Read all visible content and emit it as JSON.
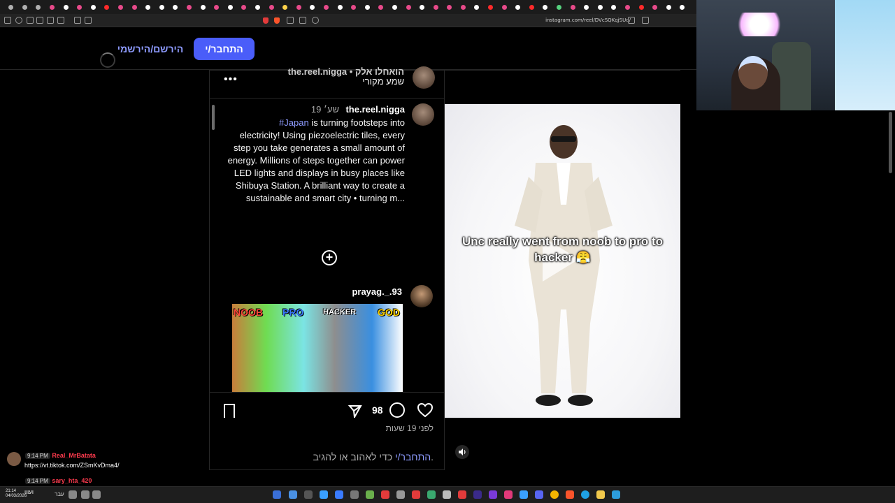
{
  "browser": {
    "tab_colors": [
      "#b0b0b0",
      "#b0b0b0",
      "#b0b0b0",
      "#e84a8a",
      "#ffffff",
      "#e84a8a",
      "#ffffff",
      "#ff2a2a",
      "#e84a8a",
      "#e84a8a",
      "#ffffff",
      "#ffffff",
      "#ffffff",
      "#e84a8a",
      "#ffffff",
      "#e84a8a",
      "#ffffff",
      "#e84a8a",
      "#ffffff",
      "#e84a8a",
      "#ffd24a",
      "#e84a8a",
      "#ffffff",
      "#e84a8a",
      "#ffffff",
      "#e84a8a",
      "#ffffff",
      "#e84a8a",
      "#ffffff",
      "#e84a8a",
      "#ffffff",
      "#e84a8a",
      "#e84a8a",
      "#e84a8a",
      "#ffffff",
      "#ff2a2a",
      "#e84a8a",
      "#ffffff",
      "#ff2a2a",
      "#ffffff",
      "#56d27f",
      "#e84a8a",
      "#ffffff",
      "#ffffff",
      "#ffffff",
      "#e84a8a",
      "#ff2a2a",
      "#e84a8a",
      "#ffffff",
      "#ffffff"
    ],
    "url": "instagram.com/reel/DVcSQKqjSUd/"
  },
  "nav": {
    "login_label": "התחבר/י",
    "signup_label": "הירשם/הירשמי"
  },
  "post": {
    "header_user": "the.reel.nigga • הואחלו אלק",
    "audio_label": "שמע מקורי",
    "caption_user": "the.reel.nigga",
    "caption_time": "19 שע׳",
    "caption_tag": "#Japan",
    "caption_line1": " is turning footsteps into",
    "caption_body": "electricity! Using piezoelectric tiles, every step you take generates a small amount of energy. Millions of steps together can power LED lights and displays in busy places like Shibuya Station. A brilliant way to create a sustainable and smart city • turning m...",
    "comment_user": "prayag._.93",
    "thumb_labels": [
      "NOOB",
      "PRO",
      "HACKER",
      "GOD"
    ],
    "comment_count": "98",
    "post_age": "לפני 19 שעות",
    "login_prompt_link": "התחבר/י",
    "login_prompt_rest": " כדי לאהוב או להגיב.",
    "overlay_text": "Unc really went from noob to pro to hacker 😤"
  },
  "chat": {
    "msg1_time": "9:14 PM",
    "msg1_user": "Real_MrBatata",
    "msg1_text": "https://vt.tiktok.com/ZSmKvDma4/",
    "msg2_time": "9:14 PM",
    "msg2_user": "sary_hta_420"
  },
  "taskbar": {
    "clock_time": "21:14",
    "clock_date": "04/03/2026",
    "lang": "עבר",
    "notif": "ועווו"
  },
  "colors": {
    "accent": "#4a5df9",
    "link": "#8e9bff",
    "background": "#000000",
    "border": "#262626"
  }
}
